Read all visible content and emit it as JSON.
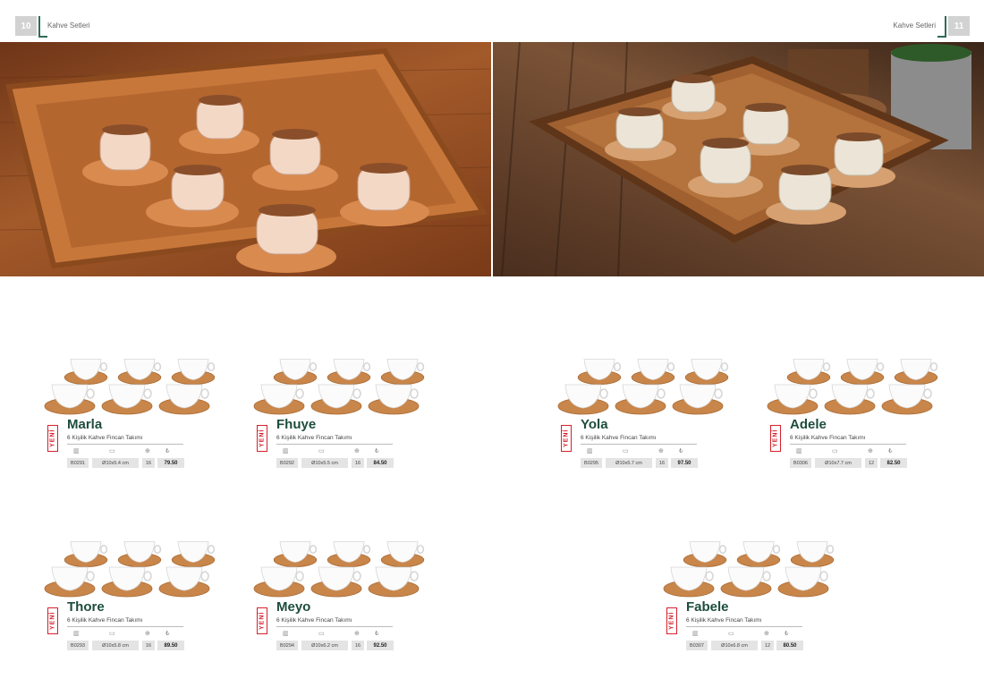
{
  "header": {
    "left_page": "10",
    "right_page": "11",
    "left_section": "Kahve Setleri",
    "right_section": "Kahve Setleri"
  },
  "badge": "YENİ",
  "icons": [
    "barcode-icon",
    "ruler-icon",
    "box-icon",
    "lira-icon"
  ],
  "currency_symbol": "₺",
  "products": [
    {
      "name": "Marla",
      "desc": "6 Kişilik Kahve Fincan Takımı",
      "code": "B0291",
      "size": "Ø10x5.4 cm",
      "qty": "16",
      "price": "79.50"
    },
    {
      "name": "Fhuye",
      "desc": "6 Kişilik Kahve Fincan Takımı",
      "code": "B0292",
      "size": "Ø10x5.5 cm",
      "qty": "16",
      "price": "84.50"
    },
    {
      "name": "Yola",
      "desc": "6 Kişilik Kahve Fincan Takımı",
      "code": "B0295",
      "size": "Ø10x5.7 cm",
      "qty": "16",
      "price": "97.50"
    },
    {
      "name": "Adele",
      "desc": "6 Kişilik Kahve Fincan Takımı",
      "code": "B0306",
      "size": "Ø10x7.7 cm",
      "qty": "12",
      "price": "82.50"
    },
    {
      "name": "Thore",
      "desc": "6 Kişilik Kahve Fincan Takımı",
      "code": "B0293",
      "size": "Ø10x5.8 cm",
      "qty": "16",
      "price": "89.50"
    },
    {
      "name": "Meyo",
      "desc": "6 Kişilik Kahve Fincan Takımı",
      "code": "B0294",
      "size": "Ø10x6.2 cm",
      "qty": "16",
      "price": "92.50"
    },
    {
      "name": "Fabele",
      "desc": "6 Kişilik Kahve Fincan Takımı",
      "code": "B0307",
      "size": "Ø10x6.8 cm",
      "qty": "12",
      "price": "80.50"
    }
  ]
}
